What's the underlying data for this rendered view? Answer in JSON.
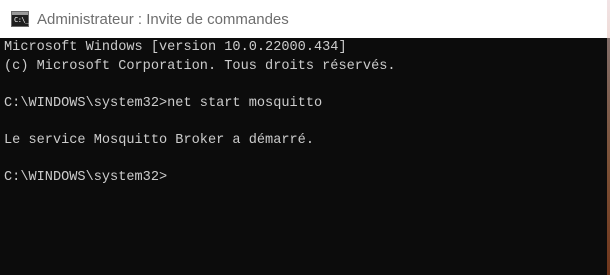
{
  "window": {
    "title": "Administrateur : Invite de commandes",
    "icon_name": "command-prompt-icon",
    "icon_text": "C:\\_"
  },
  "console": {
    "lines": [
      "Microsoft Windows [version 10.0.22000.434]",
      "(c) Microsoft Corporation. Tous droits réservés.",
      "C:\\WINDOWS\\system32>net start mosquitto",
      "Le service Mosquitto Broker a démarré.",
      "C:\\WINDOWS\\system32>"
    ],
    "background_color": "#0c0c0c",
    "text_color": "#cccccc"
  }
}
